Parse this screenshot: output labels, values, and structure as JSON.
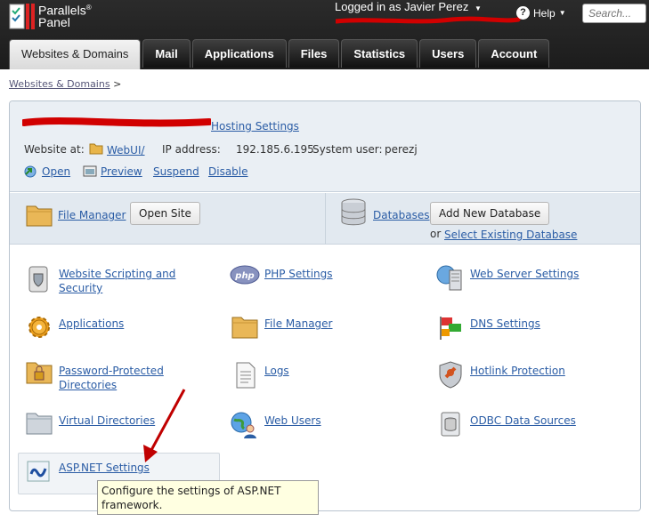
{
  "header": {
    "brand_line1": "Parallels",
    "brand_line2": "Panel",
    "logged_in_label": "Logged in as",
    "user_name": "Javier Perez",
    "help_label": "Help",
    "search_placeholder": "Search..."
  },
  "tabs": [
    {
      "label": "Websites & Domains",
      "active": true
    },
    {
      "label": "Mail"
    },
    {
      "label": "Applications"
    },
    {
      "label": "Files"
    },
    {
      "label": "Statistics"
    },
    {
      "label": "Users"
    },
    {
      "label": "Account"
    }
  ],
  "breadcrumb": {
    "item": "Websites & Domains",
    "separator": ">"
  },
  "domain": {
    "hosting_settings": "Hosting Settings",
    "website_at_label": "Website at:",
    "website_folder": "WebUI/",
    "ip_label": "IP address:",
    "ip_value": "192.185.6.195",
    "system_user_label": "System user:",
    "system_user_value": "perezj",
    "actions": [
      "Open",
      "Preview",
      "Suspend",
      "Disable"
    ]
  },
  "quick": {
    "file_manager": "File Manager",
    "open_site": "Open Site",
    "databases": "Databases",
    "add_database": "Add New Database",
    "or_label": "or",
    "select_database": "Select Existing Database"
  },
  "tools": [
    {
      "label_l1": "Website Scripting and",
      "label_l2": "Security",
      "icon": "scroll-shield-icon"
    },
    {
      "label_l1": "PHP Settings",
      "icon": "php-icon"
    },
    {
      "label_l1": "Web Server Settings",
      "icon": "server-icon"
    },
    {
      "label_l1": "Applications",
      "icon": "gear-icon"
    },
    {
      "label_l1": "File Manager",
      "icon": "folder-icon"
    },
    {
      "label_l1": "DNS Settings",
      "icon": "dns-flags-icon"
    },
    {
      "label_l1": "Password-Protected",
      "label_l2": "Directories",
      "icon": "locked-folder-icon"
    },
    {
      "label_l1": "Logs",
      "icon": "document-icon"
    },
    {
      "label_l1": "Hotlink Protection",
      "icon": "chain-shield-icon"
    },
    {
      "label_l1": "Virtual Directories",
      "icon": "folder-gray-icon"
    },
    {
      "label_l1": "Web Users",
      "icon": "globe-user-icon"
    },
    {
      "label_l1": "ODBC Data Sources",
      "icon": "odbc-icon"
    },
    {
      "label_l1": "ASP.NET Settings",
      "icon": "aspnet-icon"
    }
  ],
  "tooltip": {
    "line1": "Configure the settings of ASP.NET",
    "line2": "framework."
  },
  "colors": {
    "link": "#2a5ca5",
    "annotation_red": "#c00000",
    "tooltip_bg": "#ffffe1"
  }
}
